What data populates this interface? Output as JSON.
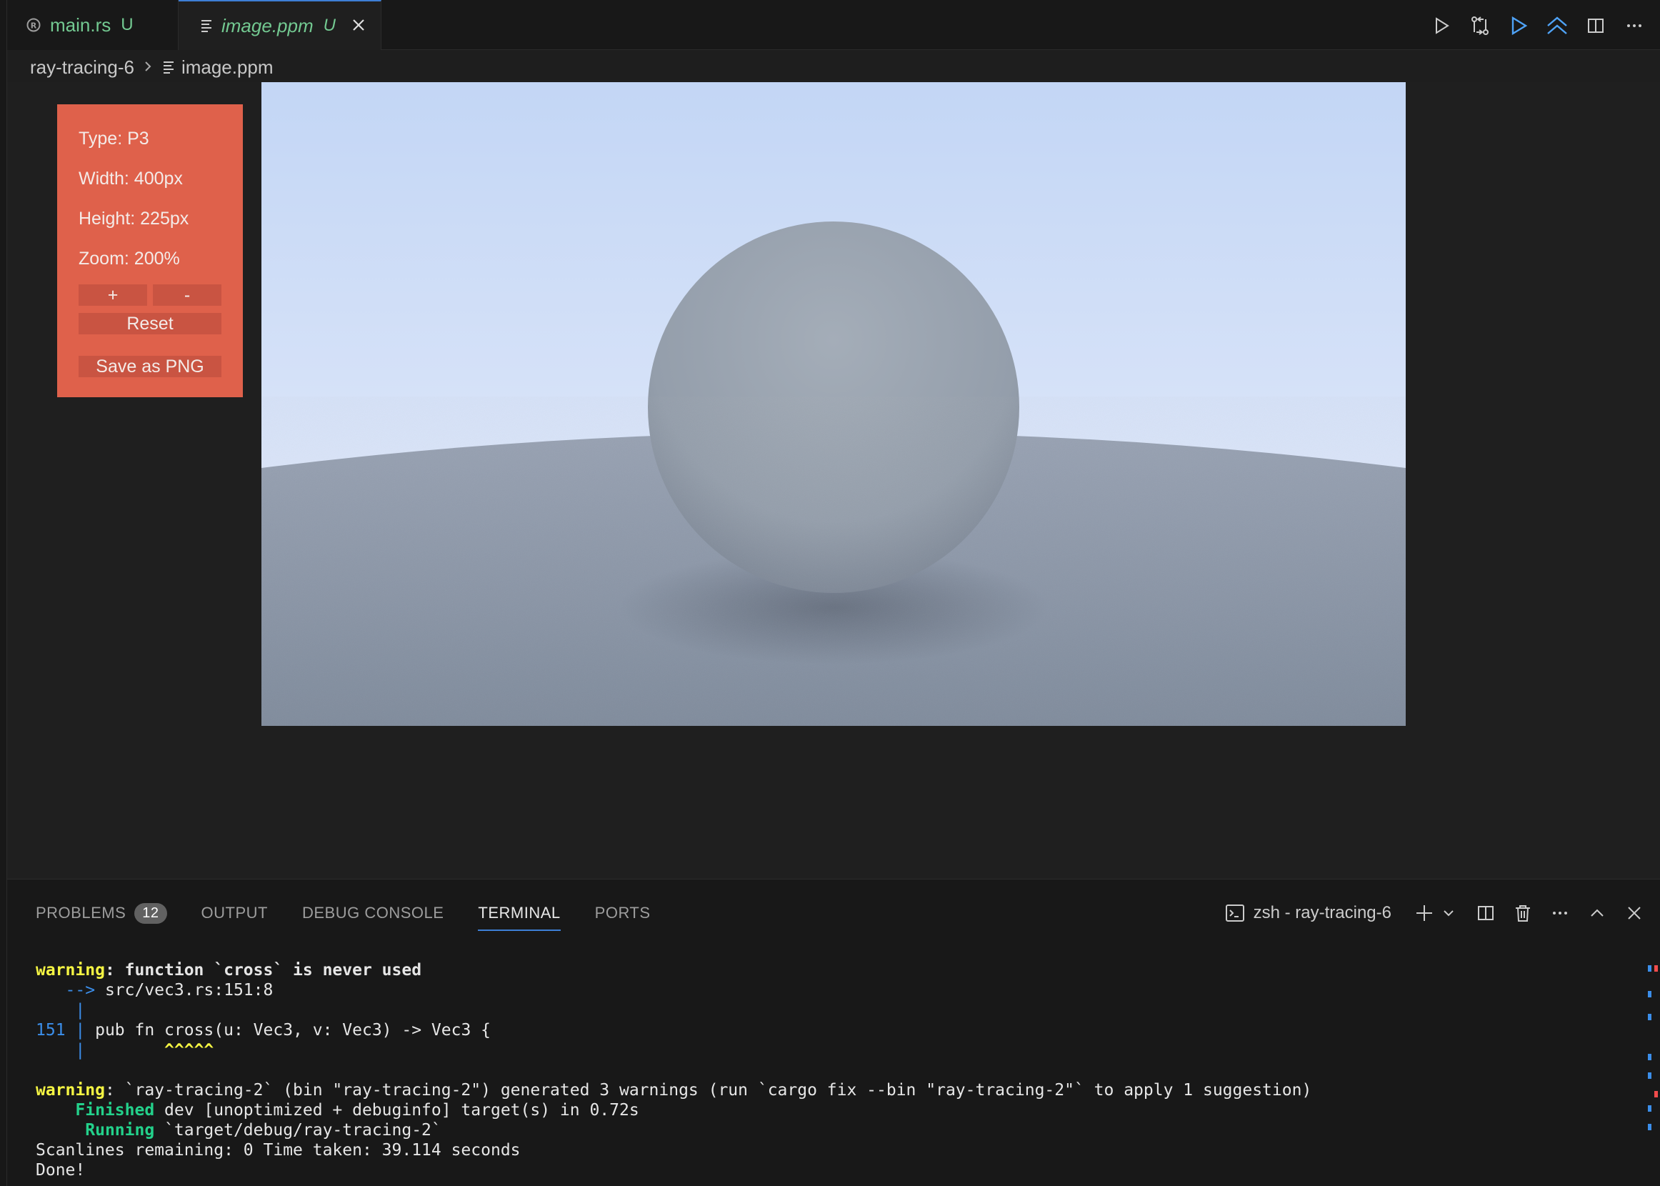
{
  "tabs": [
    {
      "icon": "rust-icon",
      "label": "main.rs",
      "status": "U"
    },
    {
      "icon": "file-lines-icon",
      "label": "image.ppm",
      "status": "U",
      "active": true
    }
  ],
  "breadcrumb": {
    "folder": "ray-tracing-6",
    "file": "image.ppm"
  },
  "image_info": {
    "type": "Type: P3",
    "width": "Width: 400px",
    "height": "Height: 225px",
    "zoom": "Zoom: 200%",
    "zoom_in": "+",
    "zoom_out": "-",
    "reset": "Reset",
    "save": "Save as PNG"
  },
  "panel": {
    "tabs": [
      {
        "label": "PROBLEMS",
        "badge": "12"
      },
      {
        "label": "OUTPUT"
      },
      {
        "label": "DEBUG CONSOLE"
      },
      {
        "label": "TERMINAL",
        "active": true
      },
      {
        "label": "PORTS"
      }
    ],
    "terminal_name": "zsh - ray-tracing-6"
  },
  "terminal": {
    "w1_label": "warning",
    "w1_text": ": function `cross` is never used",
    "w1_arrow": "   -->",
    "w1_loc": " src/vec3.rs:151:8",
    "gutter": "    |",
    "line_no": "151",
    "code": " pub fn cross(u: Vec3, v: Vec3) -> Vec3 {",
    "carets": "^^^^^",
    "w2_label": "warning",
    "w2_text": ": `ray-tracing-2` (bin \"ray-tracing-2\") generated 3 warnings (run `cargo fix --bin \"ray-tracing-2\"` to apply 1 suggestion)",
    "finished_label": "Finished",
    "finished_text": " dev [unoptimized + debuginfo] target(s) in 0.72s",
    "running_label": "Running",
    "running_text": " `target/debug/ray-tracing-2`",
    "scanlines": "Scanlines remaining: 0 Time taken: 39.114 seconds",
    "done": "Done!"
  },
  "colors": {
    "accent": "#3d7fd6",
    "modified": "#73c991",
    "info_panel": "#df614b",
    "sky_top": "#c3d6f5",
    "ground": "#8793a3",
    "sphere": "#9aa3ad"
  }
}
